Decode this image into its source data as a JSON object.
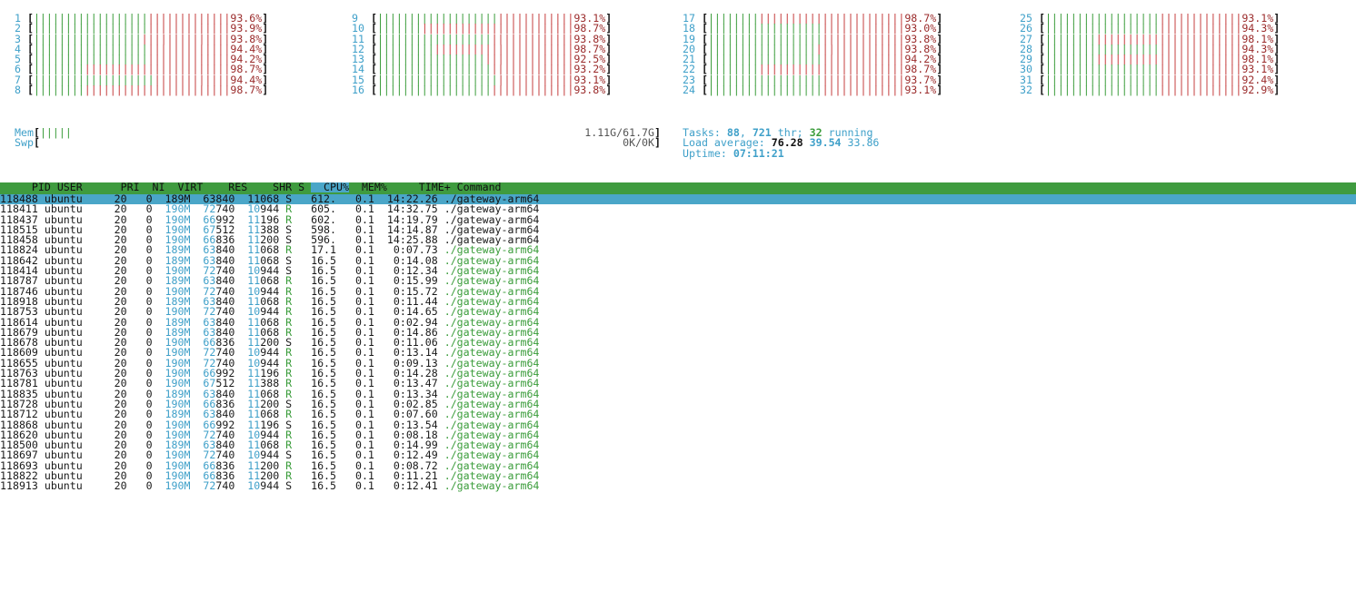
{
  "cpus": [
    {
      "id": "1",
      "green": 18,
      "red": 13,
      "pct": "93.6%"
    },
    {
      "id": "2",
      "green": 18,
      "red": 13,
      "pct": "93.9%"
    },
    {
      "id": "3",
      "green": 17,
      "red": 14,
      "pct": "93.8%"
    },
    {
      "id": "4",
      "green": 18,
      "red": 13,
      "pct": "94.4%"
    },
    {
      "id": "5",
      "green": 18,
      "red": 13,
      "pct": "94.2%"
    },
    {
      "id": "6",
      "green": 8,
      "red": 23,
      "pct": "98.7%"
    },
    {
      "id": "7",
      "green": 19,
      "red": 12,
      "pct": "94.4%"
    },
    {
      "id": "8",
      "green": 8,
      "red": 23,
      "pct": "98.7%"
    },
    {
      "id": "9",
      "green": 19,
      "red": 12,
      "pct": "93.1%"
    },
    {
      "id": "10",
      "green": 7,
      "red": 24,
      "pct": "98.7%"
    },
    {
      "id": "11",
      "green": 18,
      "red": 13,
      "pct": "93.8%"
    },
    {
      "id": "12",
      "green": 9,
      "red": 22,
      "pct": "98.7%"
    },
    {
      "id": "13",
      "green": 17,
      "red": 14,
      "pct": "92.5%"
    },
    {
      "id": "14",
      "green": 18,
      "red": 13,
      "pct": "93.2%"
    },
    {
      "id": "15",
      "green": 19,
      "red": 12,
      "pct": "93.1%"
    },
    {
      "id": "16",
      "green": 18,
      "red": 13,
      "pct": "93.8%"
    },
    {
      "id": "17",
      "green": 8,
      "red": 23,
      "pct": "98.7%"
    },
    {
      "id": "18",
      "green": 18,
      "red": 13,
      "pct": "93.0%"
    },
    {
      "id": "19",
      "green": 18,
      "red": 13,
      "pct": "93.8%"
    },
    {
      "id": "20",
      "green": 17,
      "red": 14,
      "pct": "93.8%"
    },
    {
      "id": "21",
      "green": 18,
      "red": 13,
      "pct": "94.2%"
    },
    {
      "id": "22",
      "green": 8,
      "red": 23,
      "pct": "98.7%"
    },
    {
      "id": "23",
      "green": 18,
      "red": 13,
      "pct": "93.7%"
    },
    {
      "id": "24",
      "green": 18,
      "red": 13,
      "pct": "93.1%"
    },
    {
      "id": "25",
      "green": 18,
      "red": 13,
      "pct": "93.1%"
    },
    {
      "id": "26",
      "green": 18,
      "red": 13,
      "pct": "94.3%"
    },
    {
      "id": "27",
      "green": 8,
      "red": 23,
      "pct": "98.1%"
    },
    {
      "id": "28",
      "green": 18,
      "red": 13,
      "pct": "94.3%"
    },
    {
      "id": "29",
      "green": 8,
      "red": 23,
      "pct": "98.1%"
    },
    {
      "id": "30",
      "green": 18,
      "red": 13,
      "pct": "93.1%"
    },
    {
      "id": "31",
      "green": 18,
      "red": 13,
      "pct": "92.4%"
    },
    {
      "id": "32",
      "green": 18,
      "red": 13,
      "pct": "92.9%"
    }
  ],
  "mem": {
    "label": "Mem",
    "bars": 5,
    "value": "1.11G/61.7G"
  },
  "swp": {
    "label": "Swp",
    "value": "0K/0K"
  },
  "tasks": {
    "label": "Tasks: ",
    "count": "88",
    "sep": ", ",
    "threads": "721",
    "thr_label": " thr; ",
    "running": "32",
    "running_label": " running"
  },
  "load": {
    "label": "Load average: ",
    "l1": "76.28",
    "l5": "39.54",
    "l15": "33.86"
  },
  "uptime": {
    "label": "Uptime: ",
    "value": "07:11:21"
  },
  "columns": [
    "PID",
    "USER",
    "PRI",
    "NI",
    "VIRT",
    "RES",
    "SHR",
    "S",
    "CPU%",
    "MEM%",
    "TIME+",
    "Command"
  ],
  "processes": [
    [
      "118488",
      "ubuntu",
      "20",
      "0",
      "189M",
      "63840",
      "11068",
      "S",
      "612.",
      "0.1",
      "14:22.26",
      "./gateway-arm64"
    ],
    [
      "118411",
      "ubuntu",
      "20",
      "0",
      "190M",
      "72740",
      "10944",
      "R",
      "605.",
      "0.1",
      "14:32.75",
      "./gateway-arm64"
    ],
    [
      "118437",
      "ubuntu",
      "20",
      "0",
      "190M",
      "66992",
      "11196",
      "R",
      "602.",
      "0.1",
      "14:19.79",
      "./gateway-arm64"
    ],
    [
      "118515",
      "ubuntu",
      "20",
      "0",
      "190M",
      "67512",
      "11388",
      "S",
      "598.",
      "0.1",
      "14:14.87",
      "./gateway-arm64"
    ],
    [
      "118458",
      "ubuntu",
      "20",
      "0",
      "190M",
      "66836",
      "11200",
      "S",
      "596.",
      "0.1",
      "14:25.88",
      "./gateway-arm64"
    ],
    [
      "118824",
      "ubuntu",
      "20",
      "0",
      "189M",
      "63840",
      "11068",
      "R",
      "17.1",
      "0.1",
      "0:07.73",
      "./gateway-arm64"
    ],
    [
      "118642",
      "ubuntu",
      "20",
      "0",
      "189M",
      "63840",
      "11068",
      "S",
      "16.5",
      "0.1",
      "0:14.08",
      "./gateway-arm64"
    ],
    [
      "118414",
      "ubuntu",
      "20",
      "0",
      "190M",
      "72740",
      "10944",
      "S",
      "16.5",
      "0.1",
      "0:12.34",
      "./gateway-arm64"
    ],
    [
      "118787",
      "ubuntu",
      "20",
      "0",
      "189M",
      "63840",
      "11068",
      "R",
      "16.5",
      "0.1",
      "0:15.99",
      "./gateway-arm64"
    ],
    [
      "118746",
      "ubuntu",
      "20",
      "0",
      "190M",
      "72740",
      "10944",
      "R",
      "16.5",
      "0.1",
      "0:15.72",
      "./gateway-arm64"
    ],
    [
      "118918",
      "ubuntu",
      "20",
      "0",
      "189M",
      "63840",
      "11068",
      "R",
      "16.5",
      "0.1",
      "0:11.44",
      "./gateway-arm64"
    ],
    [
      "118753",
      "ubuntu",
      "20",
      "0",
      "190M",
      "72740",
      "10944",
      "R",
      "16.5",
      "0.1",
      "0:14.65",
      "./gateway-arm64"
    ],
    [
      "118614",
      "ubuntu",
      "20",
      "0",
      "189M",
      "63840",
      "11068",
      "R",
      "16.5",
      "0.1",
      "0:02.94",
      "./gateway-arm64"
    ],
    [
      "118679",
      "ubuntu",
      "20",
      "0",
      "189M",
      "63840",
      "11068",
      "R",
      "16.5",
      "0.1",
      "0:14.86",
      "./gateway-arm64"
    ],
    [
      "118678",
      "ubuntu",
      "20",
      "0",
      "190M",
      "66836",
      "11200",
      "S",
      "16.5",
      "0.1",
      "0:11.06",
      "./gateway-arm64"
    ],
    [
      "118609",
      "ubuntu",
      "20",
      "0",
      "190M",
      "72740",
      "10944",
      "R",
      "16.5",
      "0.1",
      "0:13.14",
      "./gateway-arm64"
    ],
    [
      "118655",
      "ubuntu",
      "20",
      "0",
      "190M",
      "72740",
      "10944",
      "R",
      "16.5",
      "0.1",
      "0:09.13",
      "./gateway-arm64"
    ],
    [
      "118763",
      "ubuntu",
      "20",
      "0",
      "190M",
      "66992",
      "11196",
      "R",
      "16.5",
      "0.1",
      "0:14.28",
      "./gateway-arm64"
    ],
    [
      "118781",
      "ubuntu",
      "20",
      "0",
      "190M",
      "67512",
      "11388",
      "R",
      "16.5",
      "0.1",
      "0:13.47",
      "./gateway-arm64"
    ],
    [
      "118835",
      "ubuntu",
      "20",
      "0",
      "189M",
      "63840",
      "11068",
      "R",
      "16.5",
      "0.1",
      "0:13.34",
      "./gateway-arm64"
    ],
    [
      "118728",
      "ubuntu",
      "20",
      "0",
      "190M",
      "66836",
      "11200",
      "S",
      "16.5",
      "0.1",
      "0:02.85",
      "./gateway-arm64"
    ],
    [
      "118712",
      "ubuntu",
      "20",
      "0",
      "189M",
      "63840",
      "11068",
      "R",
      "16.5",
      "0.1",
      "0:07.60",
      "./gateway-arm64"
    ],
    [
      "118868",
      "ubuntu",
      "20",
      "0",
      "190M",
      "66992",
      "11196",
      "S",
      "16.5",
      "0.1",
      "0:13.54",
      "./gateway-arm64"
    ],
    [
      "118620",
      "ubuntu",
      "20",
      "0",
      "190M",
      "72740",
      "10944",
      "R",
      "16.5",
      "0.1",
      "0:08.18",
      "./gateway-arm64"
    ],
    [
      "118500",
      "ubuntu",
      "20",
      "0",
      "189M",
      "63840",
      "11068",
      "R",
      "16.5",
      "0.1",
      "0:14.99",
      "./gateway-arm64"
    ],
    [
      "118697",
      "ubuntu",
      "20",
      "0",
      "190M",
      "72740",
      "10944",
      "S",
      "16.5",
      "0.1",
      "0:12.49",
      "./gateway-arm64"
    ],
    [
      "118693",
      "ubuntu",
      "20",
      "0",
      "190M",
      "66836",
      "11200",
      "R",
      "16.5",
      "0.1",
      "0:08.72",
      "./gateway-arm64"
    ],
    [
      "118822",
      "ubuntu",
      "20",
      "0",
      "190M",
      "66836",
      "11200",
      "R",
      "16.5",
      "0.1",
      "0:11.21",
      "./gateway-arm64"
    ],
    [
      "118913",
      "ubuntu",
      "20",
      "0",
      "190M",
      "72740",
      "10944",
      "S",
      "16.5",
      "0.1",
      "0:12.41",
      "./gateway-arm64"
    ]
  ],
  "selected_row": 0,
  "colors": {
    "header_bg": "#3f9b3f",
    "selected_bg": "#4aa6c8",
    "bar_green": "#3a9c3a",
    "bar_red": "#c43b3b",
    "accent_cyan": "#3fa0c9"
  }
}
